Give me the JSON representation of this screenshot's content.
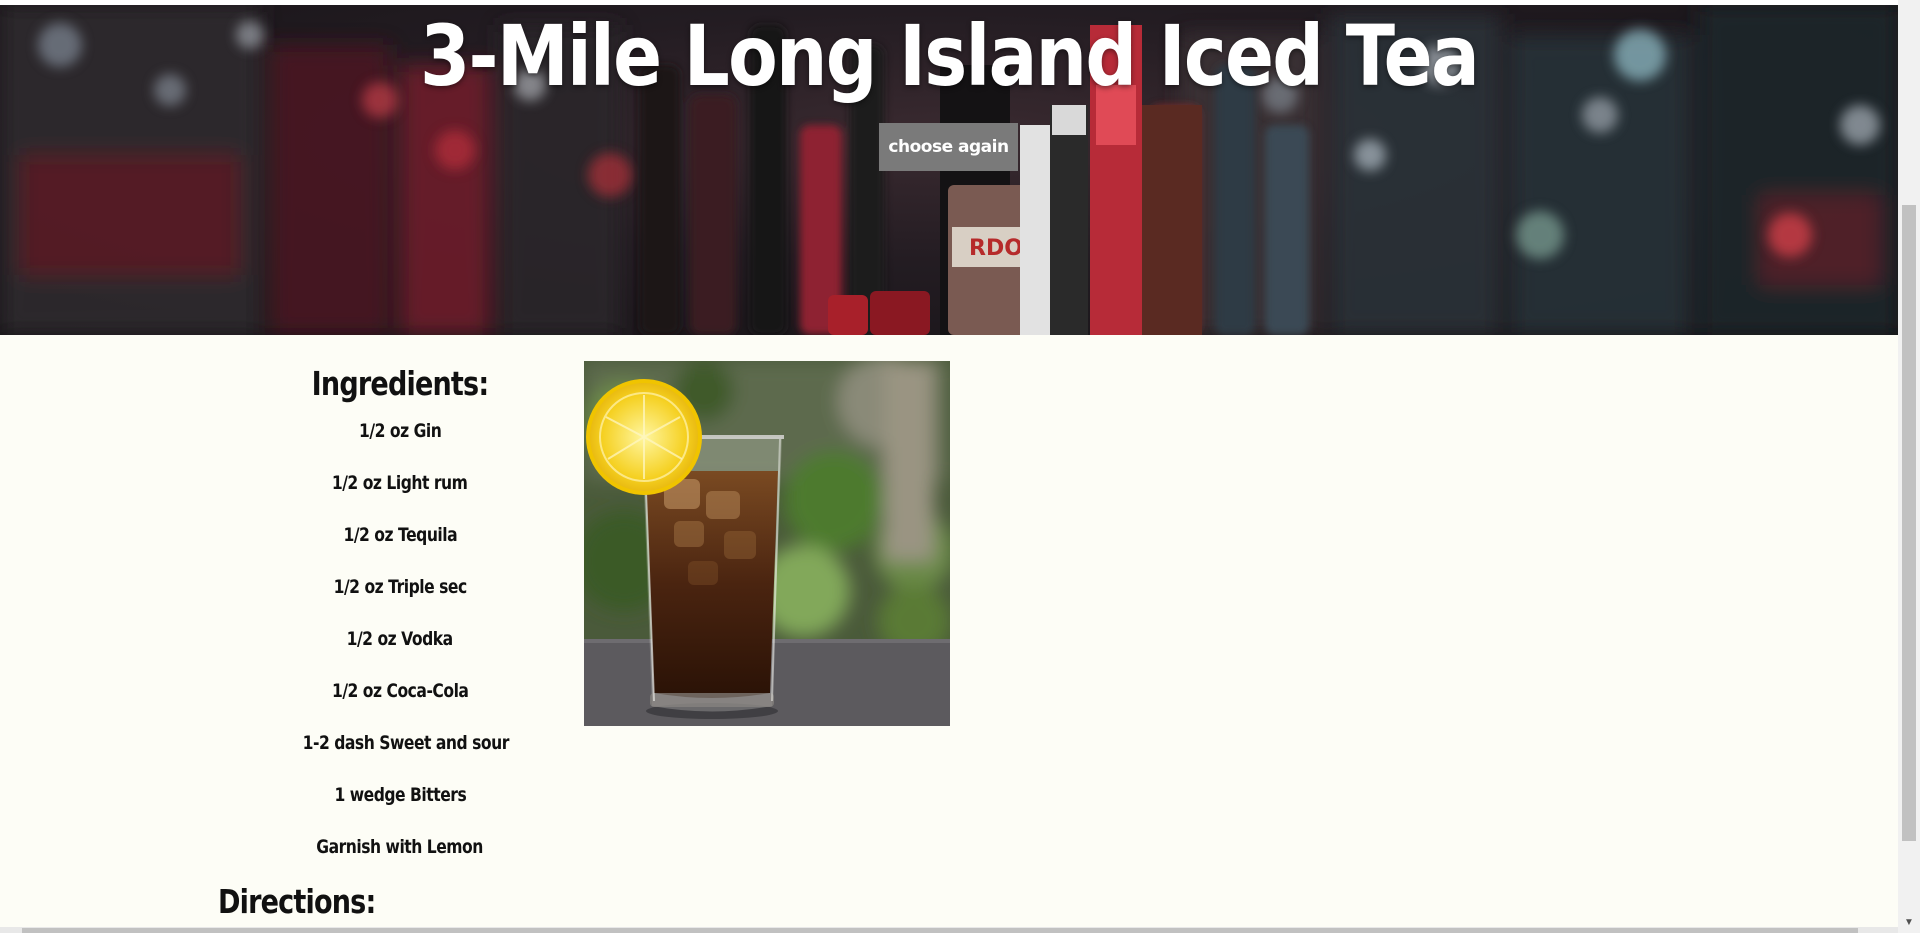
{
  "hero": {
    "title": "3-Mile Long Island Iced Tea",
    "button_label": "choose again"
  },
  "ingredients": {
    "heading": "Ingredients:",
    "items": [
      "1/2 oz Gin",
      "1/2 oz Light rum",
      "1/2 oz Tequila",
      "1/2 oz Triple sec",
      "1/2 oz Vodka",
      "1/2 oz Coca-Cola",
      "1-2 dash Sweet and sour",
      "1 wedge Bitters",
      "Garnish with Lemon"
    ]
  },
  "directions": {
    "heading": "Directions:"
  },
  "images": {
    "hero_background": "bar-bottles-background",
    "drink_photo": "iced-tea-glass-with-lemon"
  },
  "colors": {
    "page_background": "#fdfdf6",
    "button_background": "#7a7a7a",
    "title_text": "#ffffff",
    "body_text": "#111111"
  }
}
